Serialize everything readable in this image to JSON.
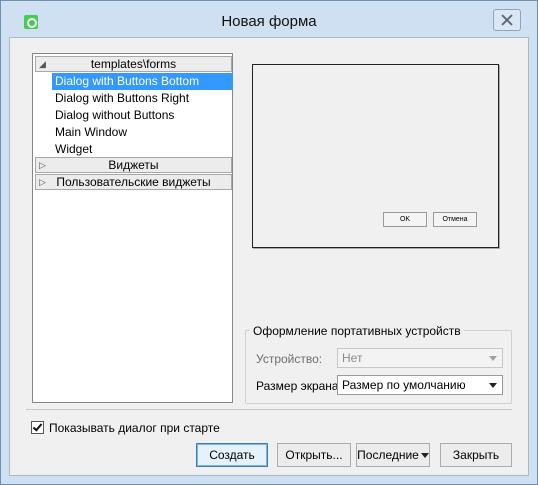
{
  "window": {
    "title": "Новая форма",
    "icon": "qt-designer-icon"
  },
  "templates": {
    "categories": [
      {
        "label": "templates\\forms",
        "expanded": true
      },
      {
        "label": "Виджеты",
        "expanded": false
      },
      {
        "label": "Пользовательские виджеты",
        "expanded": false
      }
    ],
    "items": [
      {
        "label": "Dialog with Buttons Bottom",
        "selected": true
      },
      {
        "label": "Dialog with Buttons Right",
        "selected": false
      },
      {
        "label": "Dialog without Buttons",
        "selected": false
      },
      {
        "label": "Main Window",
        "selected": false
      },
      {
        "label": "Widget",
        "selected": false
      }
    ]
  },
  "preview": {
    "ok_label": "OK",
    "cancel_label": "Отмена"
  },
  "device_group": {
    "title": "Оформление портативных устройств",
    "device_label": "Устройство:",
    "device_value": "Нет",
    "screen_label": "Размер экрана:",
    "screen_value": "Размер по умолчанию"
  },
  "footer": {
    "show_on_start_label": "Показывать диалог при старте",
    "show_on_start_checked": true,
    "buttons": {
      "create": "Создать",
      "open": "Открыть...",
      "recent": "Последние",
      "close": "Закрыть"
    }
  },
  "colors": {
    "selection": "#3399ff",
    "window_frame": "#cfe0f3"
  }
}
